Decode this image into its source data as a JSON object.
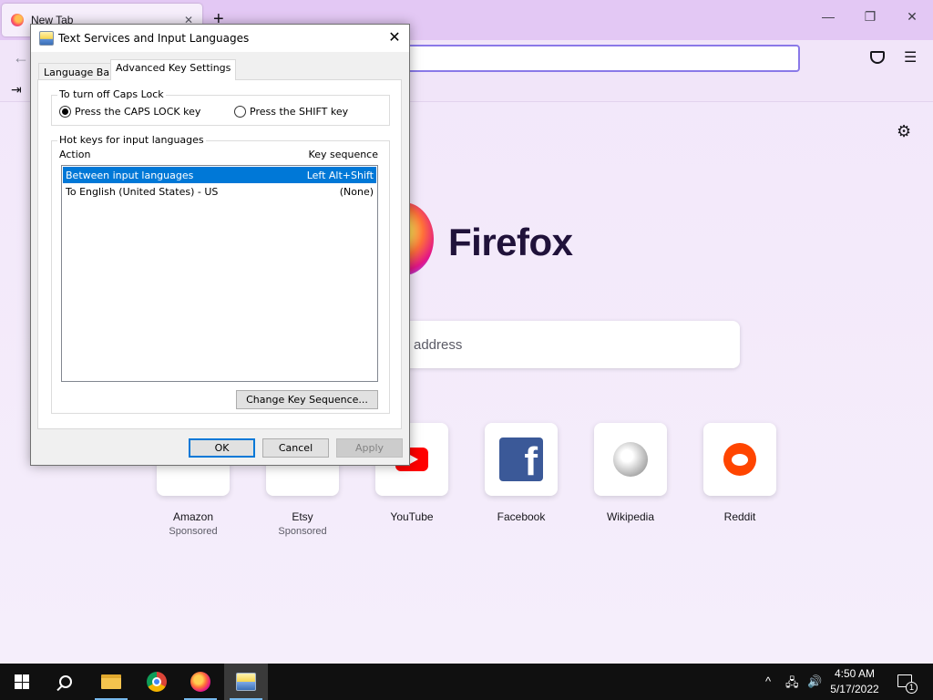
{
  "firefox": {
    "tab_title": "New Tab",
    "tab_close": "✕",
    "new_tab": "+",
    "window_controls": {
      "minimize": "—",
      "restore": "❐",
      "close": "✕"
    },
    "back_icon": "←",
    "menu_icon": "☰",
    "import_icon": "⇥",
    "gear_icon": "⚙",
    "wordmark": "Firefox",
    "search_placeholder": "address",
    "shortcuts": [
      {
        "name": "Amazon",
        "sponsor": "Sponsored"
      },
      {
        "name": "Etsy",
        "sponsor": "Sponsored"
      },
      {
        "name": "YouTube",
        "sponsor": ""
      },
      {
        "name": "Facebook",
        "sponsor": "",
        "glyph": "f"
      },
      {
        "name": "Wikipedia",
        "sponsor": ""
      },
      {
        "name": "Reddit",
        "sponsor": ""
      }
    ],
    "accent_color": "#8a79e8"
  },
  "dialog": {
    "title": "Text Services and Input Languages",
    "close": "✕",
    "tabs": [
      {
        "label": "Language Bar",
        "active": false
      },
      {
        "label": "Advanced Key Settings",
        "active": true
      }
    ],
    "caps_group": {
      "label": "To turn off Caps Lock",
      "options": [
        {
          "label": "Press the CAPS LOCK key",
          "checked": true
        },
        {
          "label": "Press the SHIFT key",
          "checked": false
        }
      ]
    },
    "hotkeys_group": {
      "label": "Hot keys for input languages",
      "columns": {
        "action": "Action",
        "key_sequence": "Key sequence"
      },
      "rows": [
        {
          "action": "Between input languages",
          "key": "Left Alt+Shift",
          "selected": true
        },
        {
          "action": "To English (United States) - US",
          "key": "(None)",
          "selected": false
        }
      ],
      "change_button": "Change Key Sequence..."
    },
    "buttons": {
      "ok": "OK",
      "cancel": "Cancel",
      "apply": "Apply"
    },
    "selection_color": "#0078d7"
  },
  "taskbar": {
    "items": [
      "windows-start",
      "search",
      "file-explorer",
      "chrome",
      "firefox",
      "text-services"
    ],
    "tray": {
      "chevron": "^",
      "network": "🖧",
      "volume": "🔊"
    },
    "time": "4:50 AM",
    "date": "5/17/2022",
    "notification_count": "1"
  }
}
